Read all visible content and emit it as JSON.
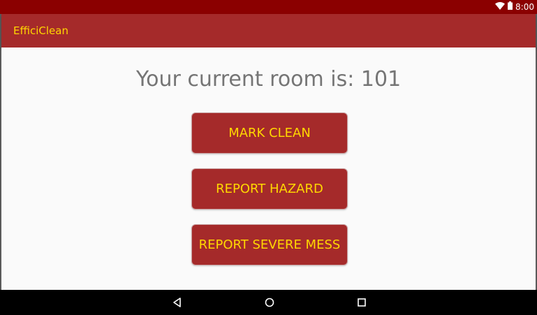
{
  "status_bar": {
    "time": "8:00",
    "background": "#8b0000"
  },
  "app_bar": {
    "title": "EfficiClean",
    "background": "#a52a2a",
    "title_color": "#ffd700"
  },
  "main": {
    "room_text": "Your current room is: 101",
    "buttons": [
      {
        "label": "MARK CLEAN"
      },
      {
        "label": "REPORT HAZARD"
      },
      {
        "label": "REPORT SEVERE MESS"
      }
    ],
    "button_color": "#a52a2a",
    "button_text_color": "#ffd700"
  },
  "nav_bar": {
    "icons": [
      "back-icon",
      "home-icon",
      "recent-apps-icon"
    ]
  }
}
